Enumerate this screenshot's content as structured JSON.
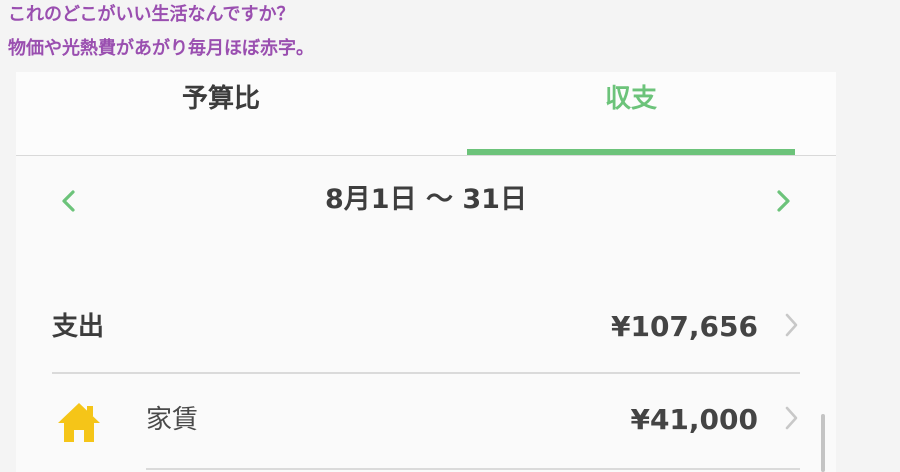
{
  "caption": {
    "line1": "これのどこがいい生活なんですか？",
    "line2": "物価や光熱費があがり毎月ほぼ赤字。"
  },
  "tabs": {
    "budget_label": "予算比",
    "income_label": "収支",
    "active": "収支"
  },
  "period": {
    "prev_icon": "chevron-left",
    "label": "8月1日 〜 31日",
    "next_icon": "chevron-right"
  },
  "expense_total": {
    "label": "支出",
    "amount": "¥107,656",
    "chevron": "›"
  },
  "categories": [
    {
      "icon": "home-icon",
      "label": "家賃",
      "amount": "¥41,000",
      "chevron": "›"
    }
  ],
  "colors": {
    "accent": "#6cc37a",
    "caption": "#9a4fb0",
    "icon_yellow": "#f5c518"
  }
}
